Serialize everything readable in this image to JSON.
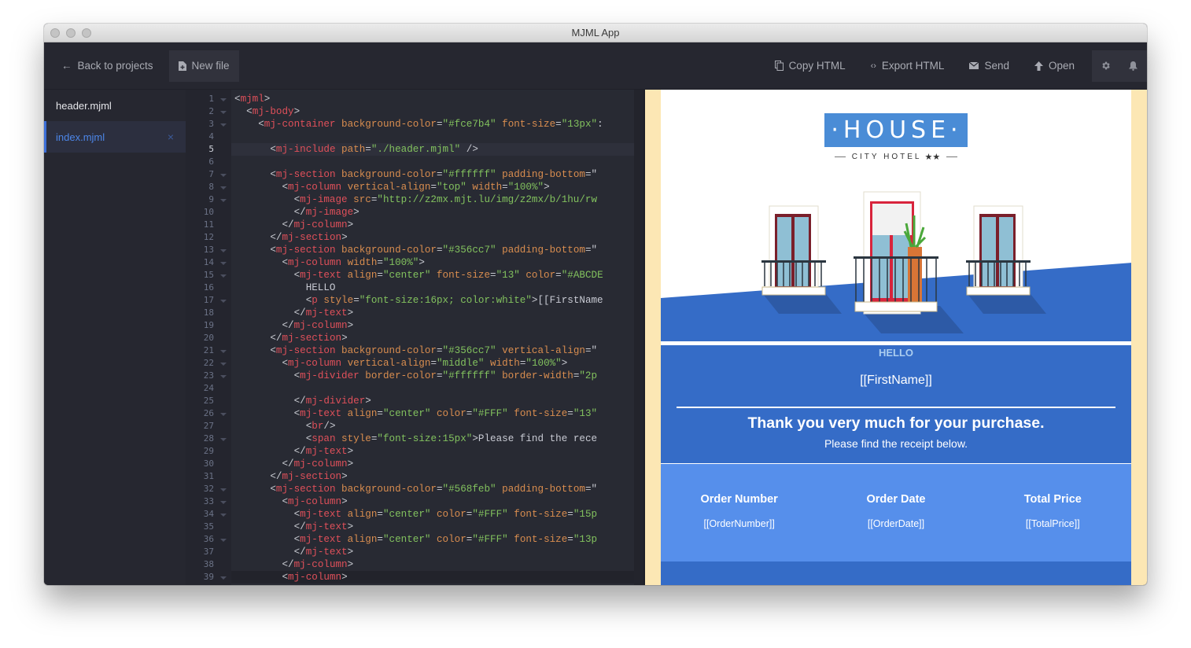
{
  "window": {
    "title": "MJML App"
  },
  "toolbar": {
    "back_label": "Back to projects",
    "new_file_label": "New file",
    "copy_html_label": "Copy HTML",
    "export_html_label": "Export HTML",
    "send_label": "Send",
    "open_label": "Open",
    "icons": [
      "gear-icon",
      "bell-icon"
    ]
  },
  "sidebar": {
    "files": [
      {
        "name": "header.mjml",
        "active": false
      },
      {
        "name": "index.mjml",
        "active": true
      }
    ],
    "close_glyph": "×"
  },
  "editor": {
    "current_line": 5,
    "lines": [
      "1",
      "2",
      "3",
      "4",
      "5",
      "6",
      "7",
      "8",
      "9",
      "10",
      "11",
      "12",
      "13",
      "14",
      "15",
      "16",
      "17",
      "18",
      "19",
      "20",
      "21",
      "22",
      "23",
      "24",
      "25",
      "26",
      "27",
      "28",
      "29",
      "30",
      "31",
      "32",
      "33",
      "34",
      "35",
      "36",
      "37",
      "38",
      "39"
    ],
    "folds": [
      1,
      2,
      3,
      7,
      8,
      9,
      13,
      14,
      15,
      17,
      21,
      22,
      23,
      26,
      28,
      32,
      33,
      34,
      36,
      39
    ],
    "code": [
      [
        [
          "p",
          "<"
        ],
        [
          "t",
          "mjml"
        ],
        [
          "p",
          ">"
        ]
      ],
      [
        [
          "x",
          "  "
        ],
        [
          "p",
          "<"
        ],
        [
          "t",
          "mj-body"
        ],
        [
          "p",
          ">"
        ]
      ],
      [
        [
          "x",
          "    "
        ],
        [
          "p",
          "<"
        ],
        [
          "t",
          "mj-container"
        ],
        [
          "a",
          " background-color"
        ],
        [
          "p",
          "="
        ],
        [
          "s",
          "\"#fce7b4\""
        ],
        [
          "a",
          " font-size"
        ],
        [
          "p",
          "="
        ],
        [
          "s",
          "\"13px\""
        ],
        [
          "p",
          ":"
        ]
      ],
      [],
      [
        [
          "x",
          "      "
        ],
        [
          "p",
          "<"
        ],
        [
          "t",
          "mj-include"
        ],
        [
          "a",
          " path"
        ],
        [
          "p",
          "="
        ],
        [
          "s",
          "\"./header.mjml\""
        ],
        [
          "p",
          " />"
        ]
      ],
      [],
      [
        [
          "x",
          "      "
        ],
        [
          "p",
          "<"
        ],
        [
          "t",
          "mj-section"
        ],
        [
          "a",
          " background-color"
        ],
        [
          "p",
          "="
        ],
        [
          "s",
          "\"#ffffff\""
        ],
        [
          "a",
          " padding-bottom"
        ],
        [
          "p",
          "=\""
        ]
      ],
      [
        [
          "x",
          "        "
        ],
        [
          "p",
          "<"
        ],
        [
          "t",
          "mj-column"
        ],
        [
          "a",
          " vertical-align"
        ],
        [
          "p",
          "="
        ],
        [
          "s",
          "\"top\""
        ],
        [
          "a",
          " width"
        ],
        [
          "p",
          "="
        ],
        [
          "s",
          "\"100%\""
        ],
        [
          "p",
          ">"
        ]
      ],
      [
        [
          "x",
          "          "
        ],
        [
          "p",
          "<"
        ],
        [
          "t",
          "mj-image"
        ],
        [
          "a",
          " src"
        ],
        [
          "p",
          "="
        ],
        [
          "s",
          "\"http://z2mx.mjt.lu/img/z2mx/b/1hu/rw"
        ]
      ],
      [
        [
          "x",
          "          "
        ],
        [
          "p",
          "</"
        ],
        [
          "t",
          "mj-image"
        ],
        [
          "p",
          ">"
        ]
      ],
      [
        [
          "x",
          "        "
        ],
        [
          "p",
          "</"
        ],
        [
          "t",
          "mj-column"
        ],
        [
          "p",
          ">"
        ]
      ],
      [
        [
          "x",
          "      "
        ],
        [
          "p",
          "</"
        ],
        [
          "t",
          "mj-section"
        ],
        [
          "p",
          ">"
        ]
      ],
      [
        [
          "x",
          "      "
        ],
        [
          "p",
          "<"
        ],
        [
          "t",
          "mj-section"
        ],
        [
          "a",
          " background-color"
        ],
        [
          "p",
          "="
        ],
        [
          "s",
          "\"#356cc7\""
        ],
        [
          "a",
          " padding-bottom"
        ],
        [
          "p",
          "=\""
        ]
      ],
      [
        [
          "x",
          "        "
        ],
        [
          "p",
          "<"
        ],
        [
          "t",
          "mj-column"
        ],
        [
          "a",
          " width"
        ],
        [
          "p",
          "="
        ],
        [
          "s",
          "\"100%\""
        ],
        [
          "p",
          ">"
        ]
      ],
      [
        [
          "x",
          "          "
        ],
        [
          "p",
          "<"
        ],
        [
          "t",
          "mj-text"
        ],
        [
          "a",
          " align"
        ],
        [
          "p",
          "="
        ],
        [
          "s",
          "\"center\""
        ],
        [
          "a",
          " font-size"
        ],
        [
          "p",
          "="
        ],
        [
          "s",
          "\"13\""
        ],
        [
          "a",
          " color"
        ],
        [
          "p",
          "="
        ],
        [
          "s",
          "\"#ABCDE"
        ]
      ],
      [
        [
          "x",
          "            HELLO"
        ]
      ],
      [
        [
          "x",
          "            "
        ],
        [
          "p",
          "<"
        ],
        [
          "t",
          "p"
        ],
        [
          "a",
          " style"
        ],
        [
          "p",
          "="
        ],
        [
          "s",
          "\"font-size:16px; color:white\""
        ],
        [
          "p",
          ">"
        ],
        [
          "x",
          "[[FirstName"
        ]
      ],
      [
        [
          "x",
          "          "
        ],
        [
          "p",
          "</"
        ],
        [
          "t",
          "mj-text"
        ],
        [
          "p",
          ">"
        ]
      ],
      [
        [
          "x",
          "        "
        ],
        [
          "p",
          "</"
        ],
        [
          "t",
          "mj-column"
        ],
        [
          "p",
          ">"
        ]
      ],
      [
        [
          "x",
          "      "
        ],
        [
          "p",
          "</"
        ],
        [
          "t",
          "mj-section"
        ],
        [
          "p",
          ">"
        ]
      ],
      [
        [
          "x",
          "      "
        ],
        [
          "p",
          "<"
        ],
        [
          "t",
          "mj-section"
        ],
        [
          "a",
          " background-color"
        ],
        [
          "p",
          "="
        ],
        [
          "s",
          "\"#356cc7\""
        ],
        [
          "a",
          " vertical-align"
        ],
        [
          "p",
          "=\""
        ]
      ],
      [
        [
          "x",
          "        "
        ],
        [
          "p",
          "<"
        ],
        [
          "t",
          "mj-column"
        ],
        [
          "a",
          " vertical-align"
        ],
        [
          "p",
          "="
        ],
        [
          "s",
          "\"middle\""
        ],
        [
          "a",
          " width"
        ],
        [
          "p",
          "="
        ],
        [
          "s",
          "\"100%\""
        ],
        [
          "p",
          ">"
        ]
      ],
      [
        [
          "x",
          "          "
        ],
        [
          "p",
          "<"
        ],
        [
          "t",
          "mj-divider"
        ],
        [
          "a",
          " border-color"
        ],
        [
          "p",
          "="
        ],
        [
          "s",
          "\"#ffffff\""
        ],
        [
          "a",
          " border-width"
        ],
        [
          "p",
          "="
        ],
        [
          "s",
          "\"2p"
        ]
      ],
      [],
      [
        [
          "x",
          "          "
        ],
        [
          "p",
          "</"
        ],
        [
          "t",
          "mj-divider"
        ],
        [
          "p",
          ">"
        ]
      ],
      [
        [
          "x",
          "          "
        ],
        [
          "p",
          "<"
        ],
        [
          "t",
          "mj-text"
        ],
        [
          "a",
          " align"
        ],
        [
          "p",
          "="
        ],
        [
          "s",
          "\"center\""
        ],
        [
          "a",
          " color"
        ],
        [
          "p",
          "="
        ],
        [
          "s",
          "\"#FFF\""
        ],
        [
          "a",
          " font-size"
        ],
        [
          "p",
          "="
        ],
        [
          "s",
          "\"13\""
        ]
      ],
      [
        [
          "x",
          "            "
        ],
        [
          "p",
          "<"
        ],
        [
          "t",
          "br"
        ],
        [
          "p",
          "/>"
        ]
      ],
      [
        [
          "x",
          "            "
        ],
        [
          "p",
          "<"
        ],
        [
          "t",
          "span"
        ],
        [
          "a",
          " style"
        ],
        [
          "p",
          "="
        ],
        [
          "s",
          "\"font-size:15px\""
        ],
        [
          "p",
          ">"
        ],
        [
          "x",
          "Please find the rece"
        ]
      ],
      [
        [
          "x",
          "          "
        ],
        [
          "p",
          "</"
        ],
        [
          "t",
          "mj-text"
        ],
        [
          "p",
          ">"
        ]
      ],
      [
        [
          "x",
          "        "
        ],
        [
          "p",
          "</"
        ],
        [
          "t",
          "mj-column"
        ],
        [
          "p",
          ">"
        ]
      ],
      [
        [
          "x",
          "      "
        ],
        [
          "p",
          "</"
        ],
        [
          "t",
          "mj-section"
        ],
        [
          "p",
          ">"
        ]
      ],
      [
        [
          "x",
          "      "
        ],
        [
          "p",
          "<"
        ],
        [
          "t",
          "mj-section"
        ],
        [
          "a",
          " background-color"
        ],
        [
          "p",
          "="
        ],
        [
          "s",
          "\"#568feb\""
        ],
        [
          "a",
          " padding-bottom"
        ],
        [
          "p",
          "=\""
        ]
      ],
      [
        [
          "x",
          "        "
        ],
        [
          "p",
          "<"
        ],
        [
          "t",
          "mj-column"
        ],
        [
          "p",
          ">"
        ]
      ],
      [
        [
          "x",
          "          "
        ],
        [
          "p",
          "<"
        ],
        [
          "t",
          "mj-text"
        ],
        [
          "a",
          " align"
        ],
        [
          "p",
          "="
        ],
        [
          "s",
          "\"center\""
        ],
        [
          "a",
          " color"
        ],
        [
          "p",
          "="
        ],
        [
          "s",
          "\"#FFF\""
        ],
        [
          "a",
          " font-size"
        ],
        [
          "p",
          "="
        ],
        [
          "s",
          "\"15p"
        ]
      ],
      [
        [
          "x",
          "          "
        ],
        [
          "p",
          "</"
        ],
        [
          "t",
          "mj-text"
        ],
        [
          "p",
          ">"
        ]
      ],
      [
        [
          "x",
          "          "
        ],
        [
          "p",
          "<"
        ],
        [
          "t",
          "mj-text"
        ],
        [
          "a",
          " align"
        ],
        [
          "p",
          "="
        ],
        [
          "s",
          "\"center\""
        ],
        [
          "a",
          " color"
        ],
        [
          "p",
          "="
        ],
        [
          "s",
          "\"#FFF\""
        ],
        [
          "a",
          " font-size"
        ],
        [
          "p",
          "="
        ],
        [
          "s",
          "\"13p"
        ]
      ],
      [
        [
          "x",
          "          "
        ],
        [
          "p",
          "</"
        ],
        [
          "t",
          "mj-text"
        ],
        [
          "p",
          ">"
        ]
      ],
      [
        [
          "x",
          "        "
        ],
        [
          "p",
          "</"
        ],
        [
          "t",
          "mj-column"
        ],
        [
          "p",
          ">"
        ]
      ],
      [
        [
          "x",
          "        "
        ],
        [
          "p",
          "<"
        ],
        [
          "t",
          "mj-column"
        ],
        [
          "p",
          ">"
        ]
      ]
    ]
  },
  "preview": {
    "background_color": "#fce7b4",
    "logo": {
      "title": "·HOUSE·",
      "subtitle": "CITY HOTEL",
      "stars": "★★"
    },
    "hello": "HELLO",
    "first_name": "[[FirstName]]",
    "thanks": "Thank you very much for your purchase.",
    "receipt_sub": "Please find the receipt below.",
    "order": [
      {
        "heading": "Order Number",
        "value": "[[OrderNumber]]"
      },
      {
        "heading": "Order Date",
        "value": "[[OrderDate]]"
      },
      {
        "heading": "Total Price",
        "value": "[[TotalPrice]]"
      }
    ],
    "colors": {
      "section_blue": "#356cc7",
      "receipt_blue": "#568feb",
      "logo_blue": "#4a8cd6"
    }
  }
}
